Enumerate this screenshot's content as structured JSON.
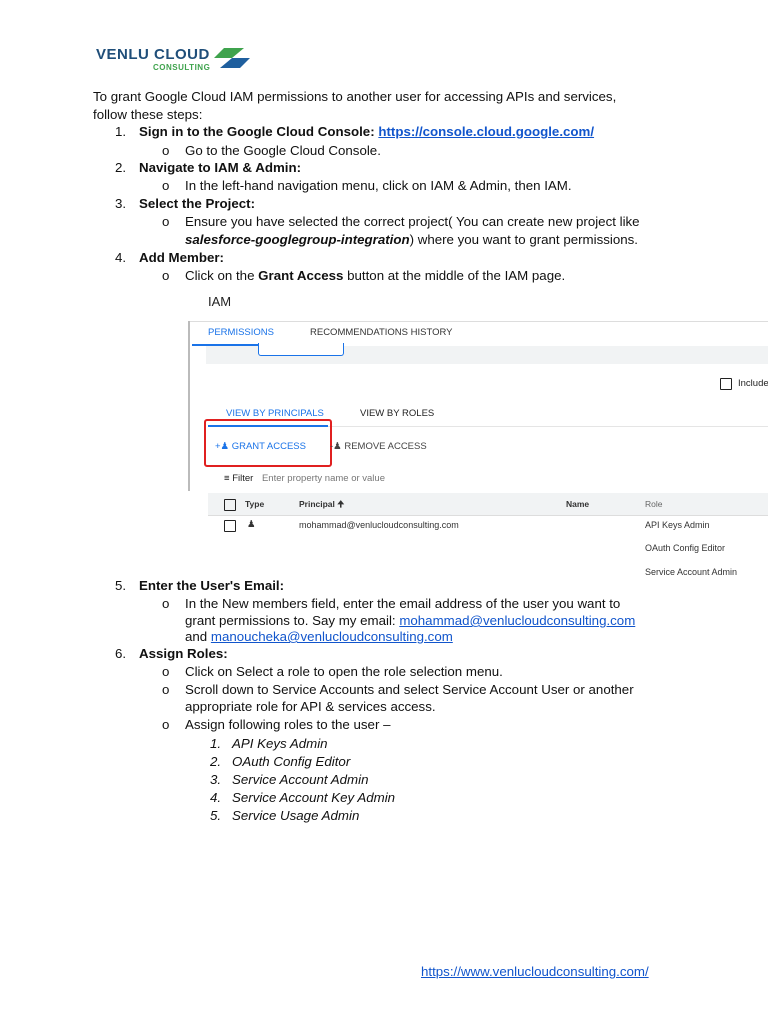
{
  "logo": {
    "name": "VENLU CLOUD",
    "tagline": "CONSULTING"
  },
  "intro": [
    "To grant Google Cloud IAM permissions to another user for accessing APIs and services,",
    "follow these steps:"
  ],
  "steps": [
    {
      "num": "1.",
      "title": "Sign in to the Google Cloud Console:",
      "link": "https://console.cloud.google.com/",
      "bullets": [
        "Go to the Google Cloud Console."
      ]
    },
    {
      "num": "2.",
      "title": "Navigate to IAM & Admin:",
      "bullets": [
        "In the left-hand navigation menu, click on IAM & Admin, then IAM."
      ]
    },
    {
      "num": "3.",
      "title": "Select the Project:",
      "bullet_line1": "Ensure you have selected the correct project( You can create new project like",
      "bullet_italic": "salesforce-googlegroup-integration",
      "bullet_line2_rest": ") where you want to grant permissions."
    },
    {
      "num": "4.",
      "title": "Add Member:",
      "bullet_pre": "Click on the ",
      "bullet_bold": "Grant Access",
      "bullet_post": " button at the middle of the IAM page."
    },
    {
      "num": "5.",
      "title": "Enter the User's Email:",
      "bullet_line1": "In the New members field, enter the email address of the user you want to",
      "bullet_line2": "grant permissions to. Say my email:  ",
      "email1": "mohammad@venlucloudconsulting.com",
      "and": "and ",
      "email2": "manoucheka@venlucloudconsulting.com"
    },
    {
      "num": "6.",
      "title": "Assign Roles:",
      "bullets": [
        "Click on Select a role to open the role selection menu.",
        "Scroll down to Service Accounts and select Service Account User or another",
        "appropriate role for API & services access.",
        "Assign following roles to the user –"
      ],
      "roles": [
        {
          "n": "1.",
          "r": "API Keys Admin"
        },
        {
          "n": "2.",
          "r": "OAuth Config Editor"
        },
        {
          "n": "3.",
          "r": "Service Account Admin"
        },
        {
          "n": "4.",
          "r": "Service Account Key Admin"
        },
        {
          "n": "5.",
          "r": "Service Usage Admin"
        }
      ]
    }
  ],
  "bullet_glyph": "o",
  "iam": {
    "title": "IAM",
    "tabs": [
      "PERMISSIONS",
      "RECOMMENDATIONS HISTORY"
    ],
    "include": "Include",
    "view_tabs": [
      "VIEW BY PRINCIPALS",
      "VIEW BY ROLES"
    ],
    "grant": "GRANT ACCESS",
    "remove": "REMOVE ACCESS",
    "filter": "Filter",
    "filter_placeholder": "Enter property name or value",
    "cols": [
      "Type",
      "Principal",
      "Name",
      "Role"
    ],
    "principal": "mohammad@venlucloudconsulting.com",
    "roles": [
      "API Keys Admin",
      "OAuth Config Editor",
      "Service Account Admin"
    ]
  },
  "footer_link": "https://www.venlucloudconsulting.com/"
}
